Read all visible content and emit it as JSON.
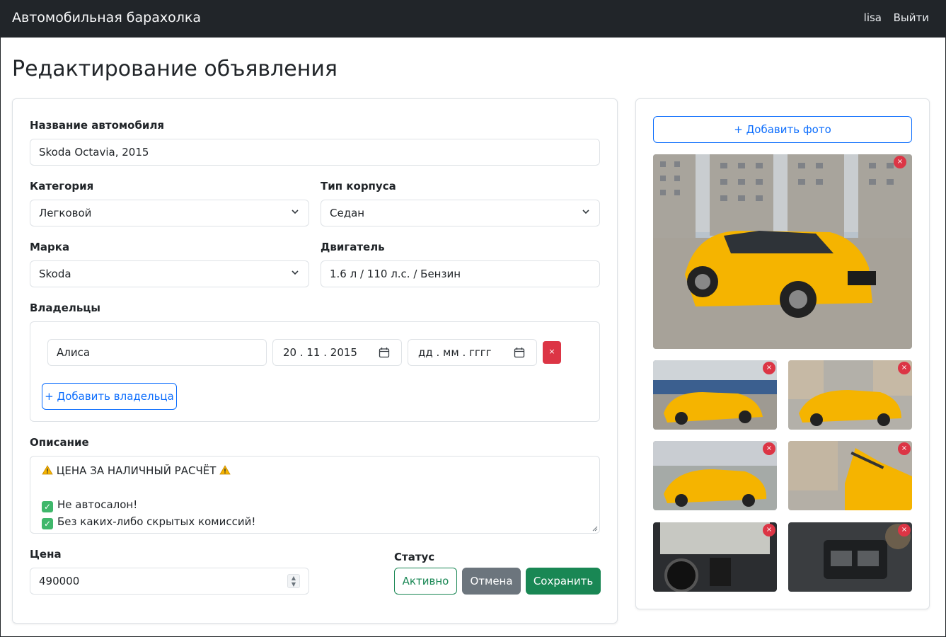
{
  "navbar": {
    "brand": "Автомобильная барахолка",
    "user": "lisa",
    "logout": "Выйти"
  },
  "page": {
    "title": "Редактирование объявления"
  },
  "form": {
    "name_label": "Название автомобиля",
    "name_value": "Skoda Octavia, 2015",
    "category_label": "Категория",
    "category_value": "Легковой",
    "body_label": "Тип корпуса",
    "body_value": "Седан",
    "brand_label": "Марка",
    "brand_value": "Skoda",
    "engine_label": "Двигатель",
    "engine_value": "1.6 л / 110 л.с. / Бензин",
    "owners_label": "Владельцы",
    "owners": [
      {
        "name": "Алиса",
        "date_from": "20 . 11 . 2015",
        "date_to_placeholder": "дд . мм . гггг",
        "remove": "×"
      }
    ],
    "add_owner": "+ Добавить владельца",
    "description_label": "Описание",
    "description_lines": [
      "ЦЕНА ЗА НАЛИЧНЫЙ РАСЧЁТ",
      "",
      "Не автосалон!",
      "Без каких-либо скрытых комиссий!"
    ],
    "price_label": "Цена",
    "price_value": "490000",
    "status_label": "Статус",
    "status_button": "Активно",
    "cancel_button": "Отмена",
    "save_button": "Сохранить"
  },
  "photos": {
    "add_button": "+ Добавить фото",
    "remove_glyph": "×",
    "items": [
      {
        "view": "front-three-quarter"
      },
      {
        "view": "front"
      },
      {
        "view": "rear"
      },
      {
        "view": "side-rear"
      },
      {
        "view": "open-trunk"
      },
      {
        "view": "interior-dashboard"
      },
      {
        "view": "door-window-controls"
      }
    ]
  },
  "colors": {
    "navbar": "#212529",
    "primary": "#0d6efd",
    "danger": "#dc3545",
    "success": "#198754",
    "secondary": "#6c757d",
    "car_yellow": "#f5b400"
  }
}
